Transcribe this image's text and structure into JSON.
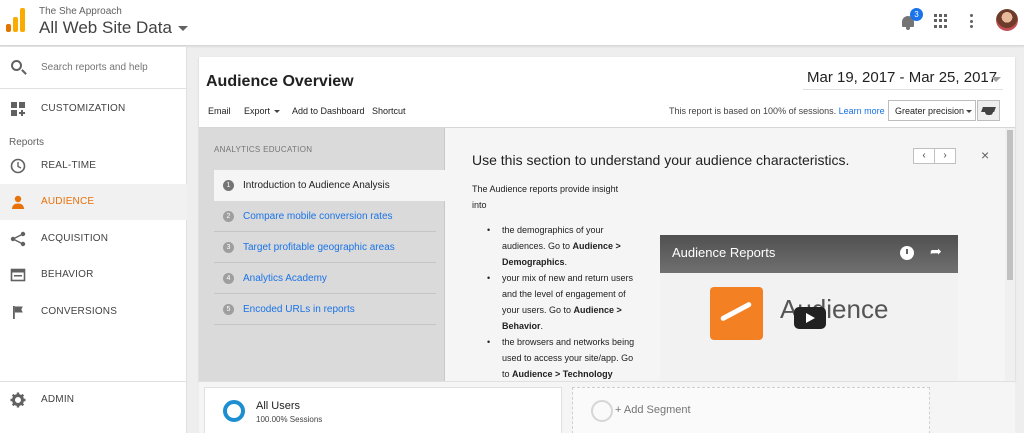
{
  "header": {
    "account_name": "The She Approach",
    "property_view": "All Web Site Data",
    "notification_count": "3",
    "icons": [
      "analytics-logo-icon",
      "bell-icon",
      "apps-grid-icon",
      "more-vert-icon",
      "avatar"
    ]
  },
  "sidebar": {
    "search_placeholder": "Search reports and help",
    "customization_label": "CUSTOMIZATION",
    "reports_heading": "Reports",
    "items": [
      {
        "label": "REAL-TIME",
        "icon": "clock-icon",
        "active": false
      },
      {
        "label": "AUDIENCE",
        "icon": "person-icon",
        "active": true
      },
      {
        "label": "ACQUISITION",
        "icon": "acquisition-icon",
        "active": false
      },
      {
        "label": "BEHAVIOR",
        "icon": "behavior-icon",
        "active": false
      },
      {
        "label": "CONVERSIONS",
        "icon": "flag-icon",
        "active": false
      }
    ],
    "admin_label": "ADMIN"
  },
  "report": {
    "title": "Audience Overview",
    "date_range": "Mar 19, 2017 - Mar 25, 2017",
    "toolbar": {
      "email": "Email",
      "export": "Export",
      "add_to_dashboard": "Add to Dashboard",
      "shortcut": "Shortcut"
    },
    "sessions_note": "This report is based on 100% of sessions.",
    "learn_more": "Learn more",
    "precision": "Greater precision"
  },
  "education": {
    "heading": "ANALYTICS EDUCATION",
    "items": [
      {
        "num": "1",
        "label": "Introduction to Audience Analysis",
        "active": true
      },
      {
        "num": "2",
        "label": "Compare mobile conversion rates",
        "active": false
      },
      {
        "num": "3",
        "label": "Target profitable geographic areas",
        "active": false
      },
      {
        "num": "4",
        "label": "Analytics Academy",
        "active": false
      },
      {
        "num": "5",
        "label": "Encoded URLs in reports",
        "active": false
      }
    ],
    "section_heading": "Use this section to understand your audience characteristics.",
    "pager_prev": "‹",
    "pager_next": "›",
    "close": "×",
    "intro": "The Audience reports provide insight into",
    "bullets": [
      {
        "before": "the demographics of your audiences. Go to ",
        "bold": "Audience > Demographics",
        "after": "."
      },
      {
        "before": "your mix of new and return users and the level of engagement of your users. Go to ",
        "bold": "Audience > Behavior",
        "after": "."
      },
      {
        "before": "the browsers and networks being used to access your site/app. Go to ",
        "bold": "Audience > Technology",
        "after": ""
      }
    ],
    "video": {
      "title": "Audience Reports",
      "brand_word": "Audience"
    }
  },
  "segments": {
    "active": {
      "title": "All Users",
      "subtitle": "100.00% Sessions"
    },
    "add": "+ Add Segment"
  },
  "colors": {
    "accent_orange": "#e8710a",
    "link_blue": "#1a73e8",
    "segment_blue": "#1d8fd1"
  }
}
